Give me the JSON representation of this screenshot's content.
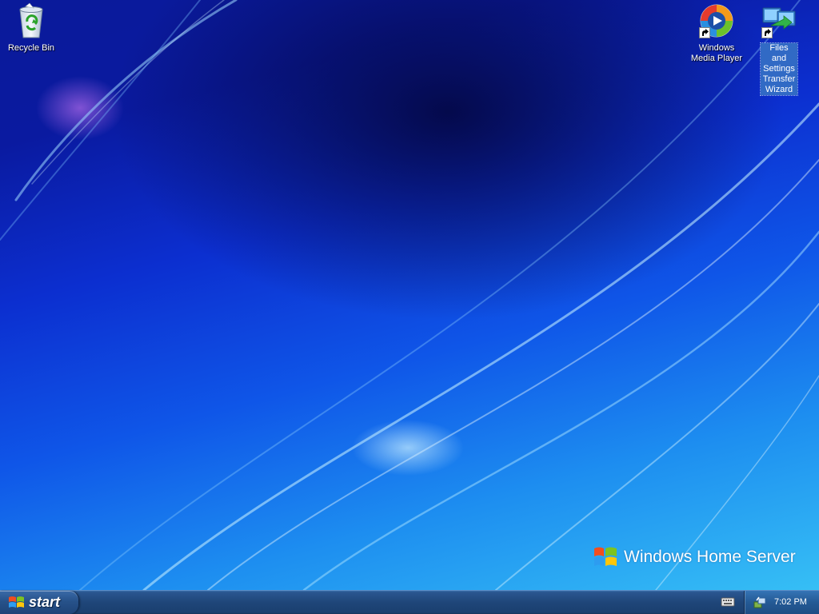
{
  "desktop": {
    "icons": [
      {
        "label": "Recycle Bin",
        "icon": "recycle-bin-icon",
        "selected": false,
        "shortcut": false
      },
      {
        "label": "Windows Media Player",
        "icon": "media-player-icon",
        "selected": false,
        "shortcut": true
      },
      {
        "label": "Files and Settings Transfer Wizard",
        "icon": "transfer-wizard-icon",
        "selected": true,
        "shortcut": true
      }
    ],
    "branding": {
      "text": "Windows Home Server",
      "icon": "windows-flag-icon"
    }
  },
  "taskbar": {
    "start_label": "start",
    "start_icon": "windows-flag-icon",
    "tray_icons": [
      "keyboard-icon",
      "network-icon"
    ],
    "clock": "7:02 PM"
  },
  "colors": {
    "taskbar": "#1f4679",
    "selection": "#316ac5",
    "accent_flag_red": "#f24e1e",
    "accent_flag_green": "#7ec320",
    "accent_flag_blue": "#2d9cf0",
    "accent_flag_yellow": "#ffc60a"
  }
}
